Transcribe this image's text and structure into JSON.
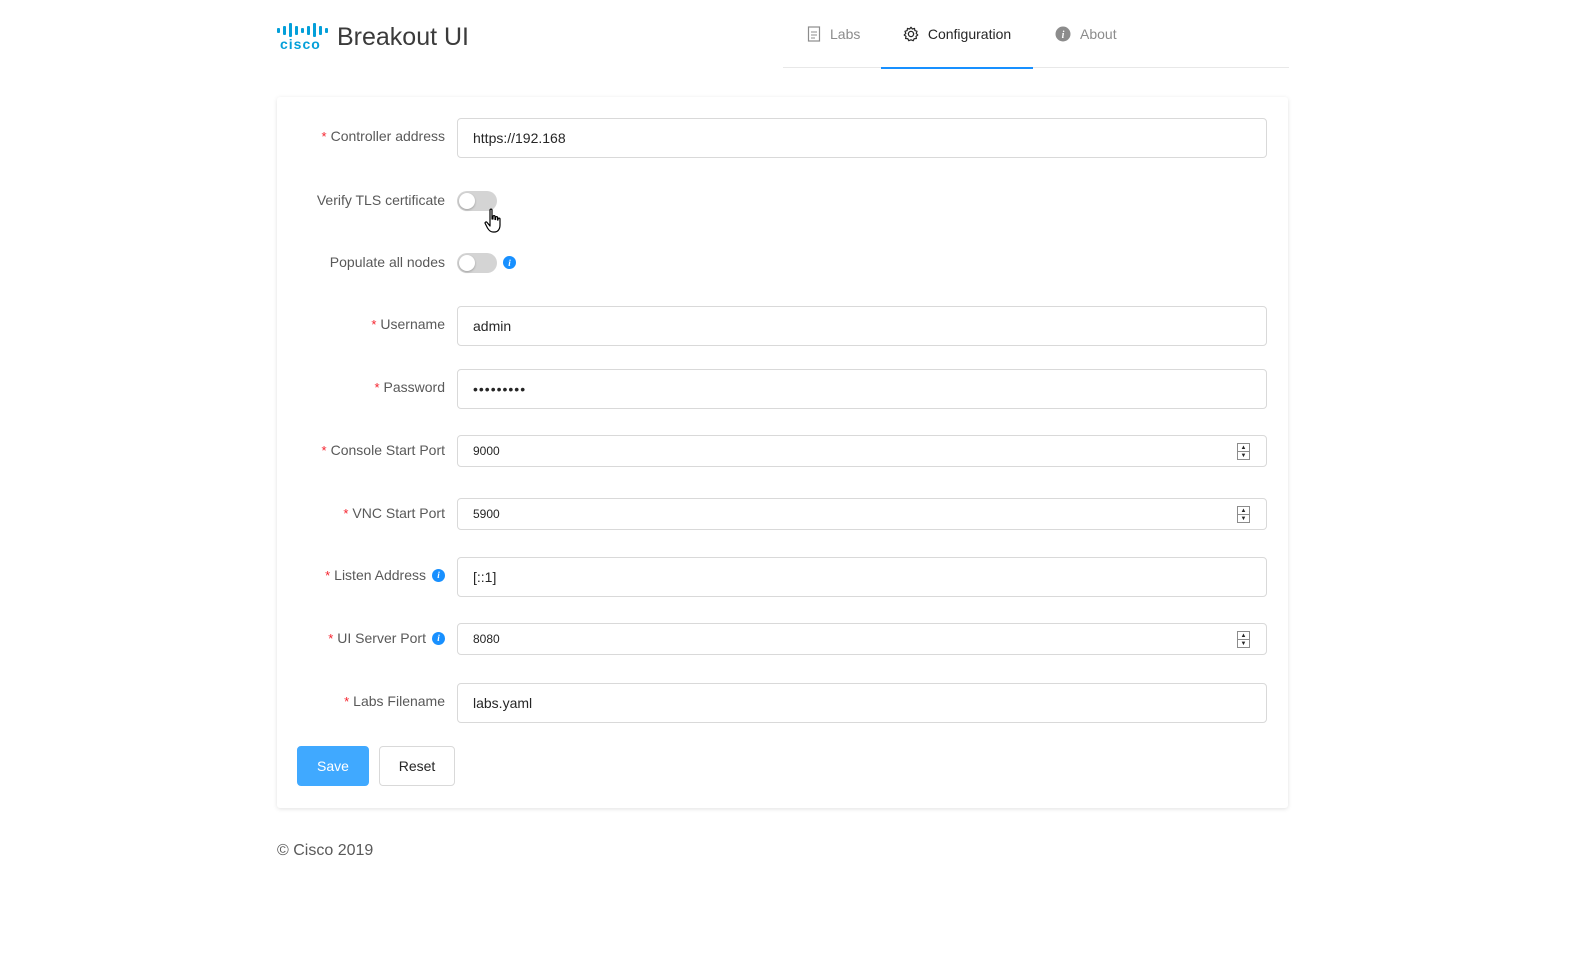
{
  "app": {
    "logo_text": "cisco",
    "title": "Breakout UI"
  },
  "nav": {
    "tabs": [
      {
        "label": "Labs",
        "icon": "document-icon",
        "active": false
      },
      {
        "label": "Configuration",
        "icon": "gear-icon",
        "active": true
      },
      {
        "label": "About",
        "icon": "info-icon",
        "active": false
      }
    ]
  },
  "form": {
    "controller_address": {
      "label": "Controller address",
      "value": "https://192.168",
      "required": true
    },
    "verify_tls": {
      "label": "Verify TLS certificate",
      "checked": false
    },
    "populate_nodes": {
      "label": "Populate all nodes",
      "checked": false
    },
    "username": {
      "label": "Username",
      "value": "admin",
      "required": true
    },
    "password": {
      "label": "Password",
      "value": "•••••••••",
      "required": true
    },
    "console_start_port": {
      "label": "Console Start Port",
      "value": "9000",
      "required": true
    },
    "vnc_start_port": {
      "label": "VNC Start Port",
      "value": "5900",
      "required": true
    },
    "listen_address": {
      "label": "Listen Address",
      "value": "[::1]",
      "required": true
    },
    "ui_server_port": {
      "label": "UI Server Port",
      "value": "8080",
      "required": true
    },
    "labs_filename": {
      "label": "Labs Filename",
      "value": "labs.yaml",
      "required": true
    },
    "required_mark": "*",
    "save_label": "Save",
    "reset_label": "Reset"
  },
  "footer": {
    "text": "© Cisco 2019"
  },
  "colors": {
    "accent": "#1890ff",
    "cisco_blue": "#049fd9",
    "required": "#f5222d"
  }
}
